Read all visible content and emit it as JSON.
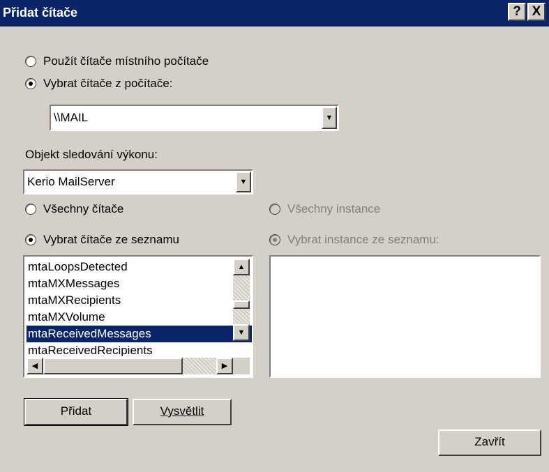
{
  "window": {
    "title": "Přidat čítače",
    "help_button": "?",
    "close_button": "X"
  },
  "source_options": {
    "local": "Použít čítače místního počítače",
    "remote": "Vybrat čítače z počítače:",
    "selected": "remote"
  },
  "computer_combo": {
    "value": "\\\\MAIL"
  },
  "object_section": {
    "label": "Objekt sledování výkonu:",
    "value": "Kerio MailServer"
  },
  "counter_options": {
    "all": "Všechny čítače",
    "from_list": "Vybrat čítače ze seznamu",
    "selected": "from_list"
  },
  "instance_options": {
    "all": "Všechny instance",
    "from_list": "Vybrat instance ze seznamu:",
    "selected": "from_list",
    "disabled": true
  },
  "counters_list": {
    "items": [
      "mtaLoopsDetected",
      "mtaMXMessages",
      "mtaMXRecipients",
      "mtaMXVolume",
      "mtaReceivedMessages",
      "mtaReceivedRecipients"
    ],
    "selected_index": 4
  },
  "instances_list": {
    "items": []
  },
  "buttons": {
    "add": "Přidat",
    "explain": "Vysvětlit",
    "close": "Zavřít"
  },
  "colors": {
    "titlebar": "#0a246a",
    "face": "#d4d0c8",
    "selection": "#0a246a"
  }
}
